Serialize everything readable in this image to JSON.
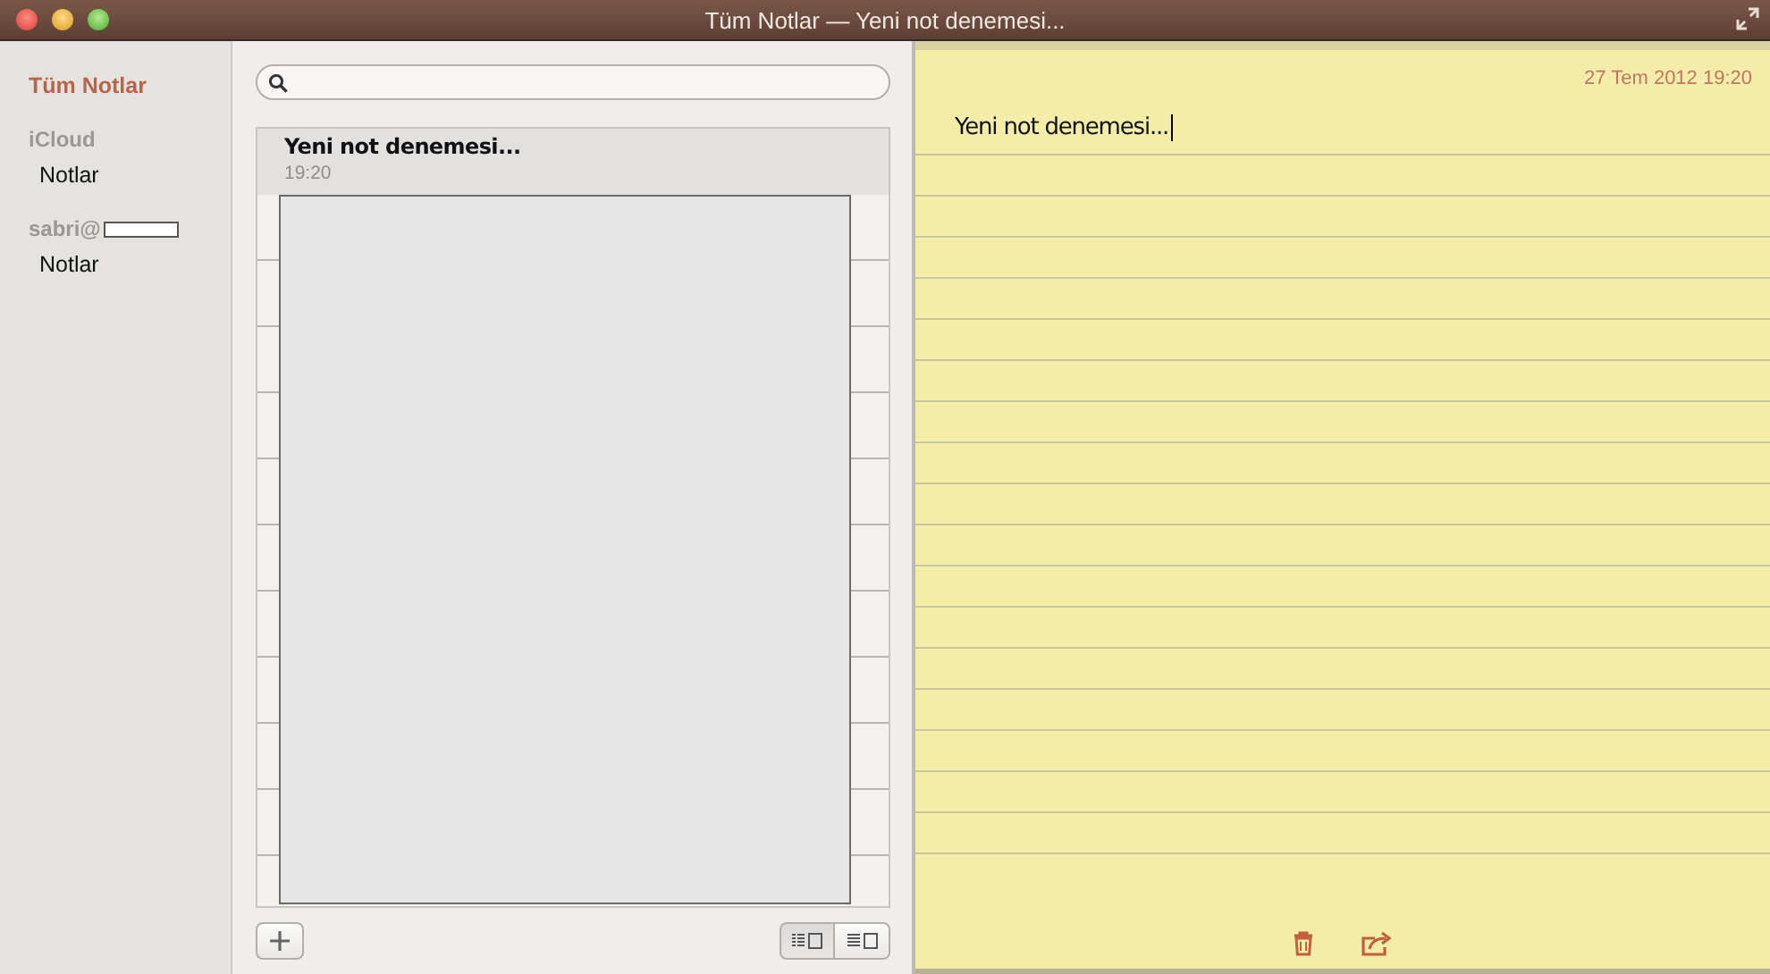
{
  "window": {
    "title": "Tüm Notlar — Yeni not denemesi..."
  },
  "sidebar": {
    "items": [
      {
        "kind": "item",
        "label": "Tüm Notlar",
        "selected": true
      },
      {
        "kind": "header",
        "label": "iCloud"
      },
      {
        "kind": "item",
        "label": "Notlar",
        "selected": false
      },
      {
        "kind": "account",
        "label": "sabri@"
      },
      {
        "kind": "item",
        "label": "Notlar",
        "selected": false
      }
    ]
  },
  "notes": [
    {
      "title": "Yeni not denemesi...",
      "time": "19:20",
      "selected": true
    }
  ],
  "view_toggle": [
    {
      "kind": "list",
      "selected": true
    },
    {
      "kind": "preview",
      "selected": false
    }
  ],
  "note": {
    "date": "27 Tem 2012 19:20",
    "body": "Yeni not denemesi..."
  }
}
